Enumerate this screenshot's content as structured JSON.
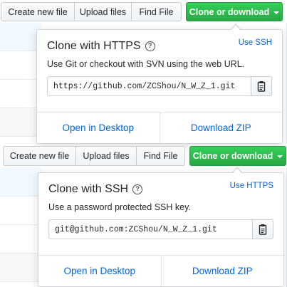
{
  "toolbar": {
    "create_new_file": "Create new file",
    "upload_files": "Upload files",
    "find_file": "Find File",
    "clone_or_download": "Clone or download"
  },
  "https_panel": {
    "title": "Clone with HTTPS",
    "toggle": "Use SSH",
    "description": "Use Git or checkout with SVN using the web URL.",
    "url": "https://github.com/ZCShou/N_W_Z_1.git",
    "open_desktop": "Open in Desktop",
    "download_zip": "Download ZIP"
  },
  "ssh_panel": {
    "title": "Clone with SSH",
    "toggle": "Use HTTPS",
    "description": "Use a password protected SSH key.",
    "url": "git@github.com:ZCShou/N_W_Z_1.git",
    "open_desktop": "Open in Desktop",
    "download_zip": "Download ZIP"
  },
  "icons": {
    "help": "question-circle-icon",
    "copy": "clippy-icon",
    "caret": "caret-down-icon"
  },
  "colors": {
    "primary_green": "#28a745",
    "link_blue": "#0366d6",
    "border": "#d1d5da"
  }
}
